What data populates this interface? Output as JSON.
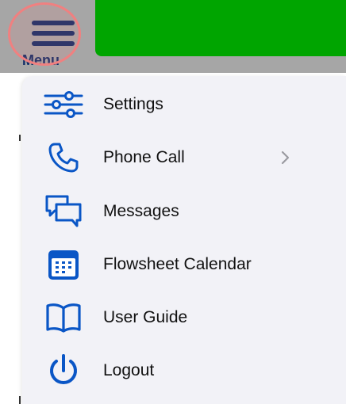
{
  "colors": {
    "accent": "#0a56c6",
    "navy": "#0d2a66",
    "green": "#00a500",
    "highlight": "#f08080"
  },
  "header": {
    "menu_label": "Menu"
  },
  "menu": {
    "items": [
      {
        "label": "Settings",
        "icon": "sliders-icon"
      },
      {
        "label": "Phone Call",
        "icon": "phone-icon",
        "has_submenu": true
      },
      {
        "label": "Messages",
        "icon": "chat-bubbles-icon"
      },
      {
        "label": "Flowsheet Calendar",
        "icon": "calendar-icon"
      },
      {
        "label": "User Guide",
        "icon": "book-icon"
      },
      {
        "label": "Logout",
        "icon": "power-icon"
      }
    ]
  }
}
